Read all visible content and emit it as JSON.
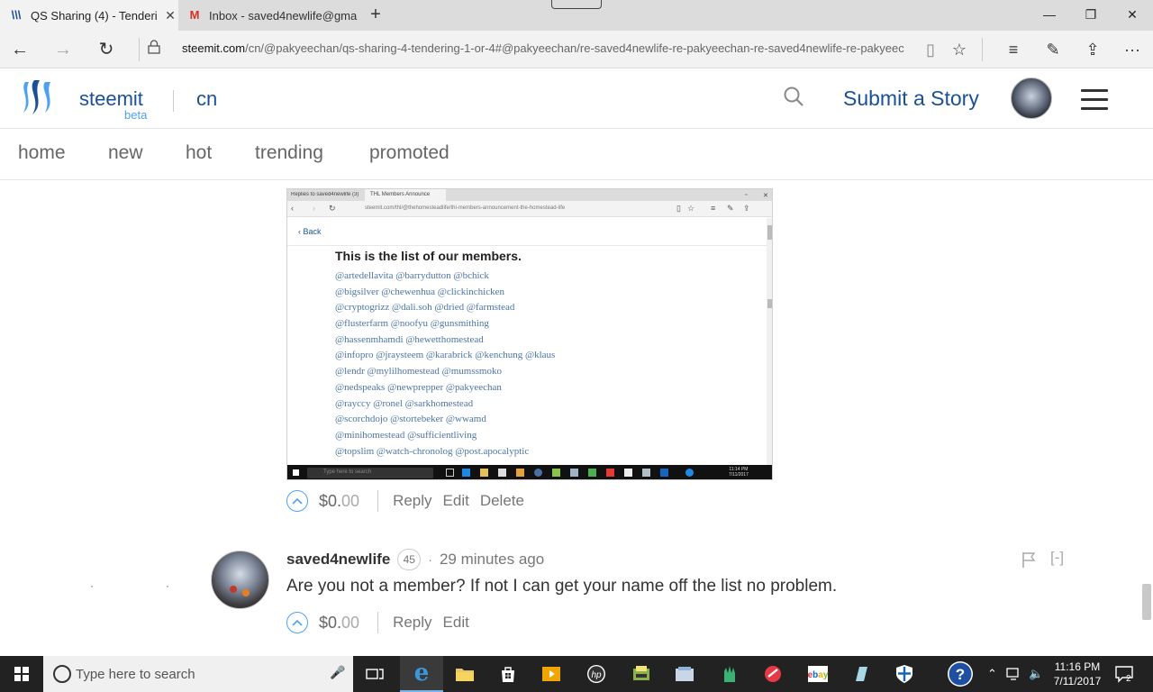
{
  "browser": {
    "tabs": [
      {
        "title": "QS Sharing (4) - Tenderi",
        "active": true
      },
      {
        "title": "Inbox - saved4newlife@gma",
        "active": false
      }
    ],
    "url_host": "steemit.com",
    "url_path": "/cn/@pakyeechan/qs-sharing-4-tendering-1-or-4#@pakyeechan/re-saved4newlife-re-pakyeechan-re-saved4newlife-re-pakyeec"
  },
  "site": {
    "brand": "steemit",
    "beta": "beta",
    "tag": "cn",
    "submit": "Submit a Story",
    "nav": [
      "home",
      "new",
      "hot",
      "trending",
      "promoted"
    ]
  },
  "embedded_screenshot": {
    "tab1": "Replies to saved4newlife (3)",
    "tab2": "THL Members Announce",
    "url": "steemit.com/thl/@thehomesteadlife/thl-members-announcement-the-homestead-life",
    "back": "Back",
    "heading": "This is the list of our members.",
    "members": [
      "@artedellavita @barrydutton @bchick",
      "@bigsilver @chewenhua @clickinchicken",
      "@cryptogrizz @dali.soh @dried @farmstead",
      "@flusterfarm @noofyu @gunsmithing",
      "@hassenmhamdi @hewetthomestead",
      "@infopro @jraysteem @karabrick @kenchung @klaus",
      "@lendr @mylilhomestead @mumssmoko",
      "@nedspeaks @newprepper @pakyeechan",
      "@rayccy @ronel @sarkhomestead",
      "@scorchdojo @stortebeker @wwamd",
      "@minihomestead @sufficientliving",
      "@topslim @watch-chronolog @post.apocalyptic"
    ],
    "search_placeholder": "Type here to search",
    "clock_time": "11:14 PM",
    "clock_date": "7/11/2017"
  },
  "post_actions": {
    "payout_whole": "$0.",
    "payout_cents": "00",
    "reply": "Reply",
    "edit": "Edit",
    "delete": "Delete"
  },
  "comment": {
    "author": "saved4newlife",
    "reputation": "45",
    "time": "29 minutes ago",
    "collapse": "[-]",
    "body": "Are you not a member? If not I can get your name off the list no problem.",
    "payout_whole": "$0.",
    "payout_cents": "00",
    "reply": "Reply",
    "edit": "Edit"
  },
  "taskbar": {
    "search_placeholder": "Type here to search",
    "time": "11:16 PM",
    "date": "7/11/2017",
    "notifications": "2"
  },
  "colors": {
    "steemit_blue": "#1a5099",
    "upvote_blue": "#4ba2f2",
    "taskbar": "#222222"
  }
}
